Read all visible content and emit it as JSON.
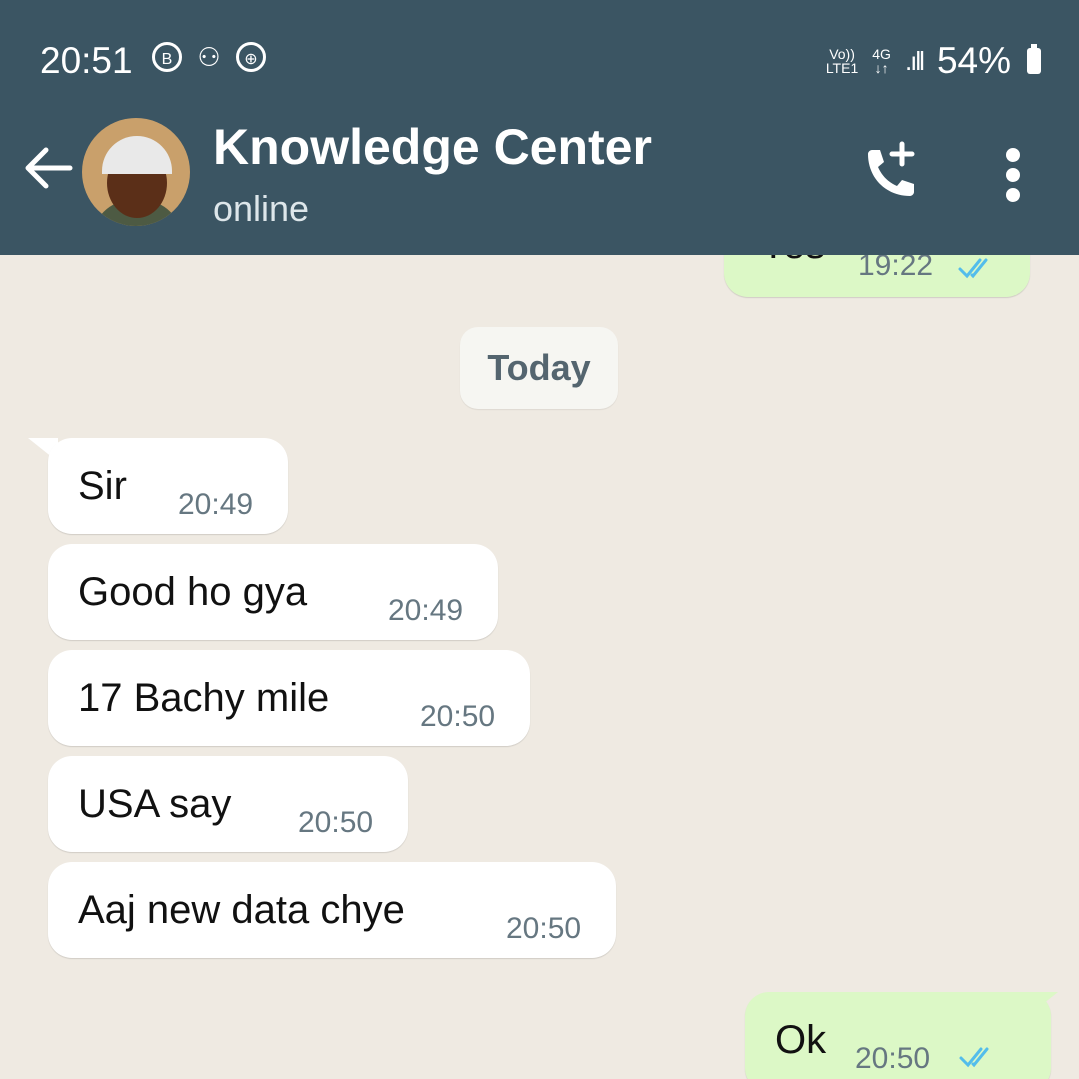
{
  "status_bar": {
    "time": "20:51",
    "network_top": "Vo))",
    "network_bottom": "LTE1",
    "data_type": "4G",
    "battery": "54%"
  },
  "header": {
    "contact_name": "Knowledge Center",
    "status": "online"
  },
  "chat": {
    "date_separator": "Today",
    "partial_outgoing": {
      "text": "Yes",
      "time": "19:22"
    },
    "messages": [
      {
        "text": "Sir",
        "time": "20:49"
      },
      {
        "text": "Good ho gya",
        "time": "20:49"
      },
      {
        "text": "17 Bachy mile",
        "time": "20:50"
      },
      {
        "text": "USA say",
        "time": "20:50"
      },
      {
        "text": "Aaj new data chye",
        "time": "20:50"
      }
    ],
    "reply": {
      "text": "Ok",
      "time": "20:50"
    }
  },
  "colors": {
    "header": "#3b5563",
    "chat_bg": "#efeae2",
    "incoming": "#ffffff",
    "outgoing": "#dcf8c6",
    "read_tick": "#53bdeb"
  }
}
